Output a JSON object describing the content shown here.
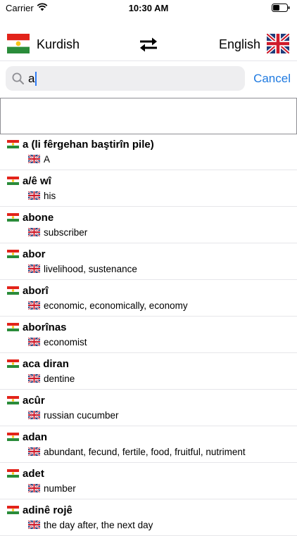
{
  "status_bar": {
    "carrier": "Carrier",
    "time": "10:30 AM"
  },
  "language_bar": {
    "source_language": "Kurdish",
    "target_language": "English"
  },
  "search": {
    "query": "a",
    "cancel_label": "Cancel"
  },
  "colors": {
    "accent": "#1f7ae0",
    "kurdish_red": "#e2231a",
    "kurdish_green": "#2a8c3a",
    "kurdish_sun": "#f7c518",
    "uk_blue": "#1f3b7a",
    "uk_red": "#cf1b2b"
  },
  "entries": [
    {
      "term": "a (li fêrgehan baştirîn pile)",
      "translation": "A"
    },
    {
      "term": "a/ê wî",
      "translation": "his"
    },
    {
      "term": "abone",
      "translation": "subscriber"
    },
    {
      "term": "abor",
      "translation": "livelihood, sustenance"
    },
    {
      "term": "aborî",
      "translation": "economic, economically, economy"
    },
    {
      "term": "aborînas",
      "translation": "economist"
    },
    {
      "term": "aca diran",
      "translation": "dentine"
    },
    {
      "term": "acûr",
      "translation": "russian cucumber"
    },
    {
      "term": "adan",
      "translation": "abundant, fecund, fertile, food, fruitful, nutriment"
    },
    {
      "term": "adet",
      "translation": "number"
    },
    {
      "term": "adinê rojê",
      "translation": "the day after, the next day"
    }
  ]
}
